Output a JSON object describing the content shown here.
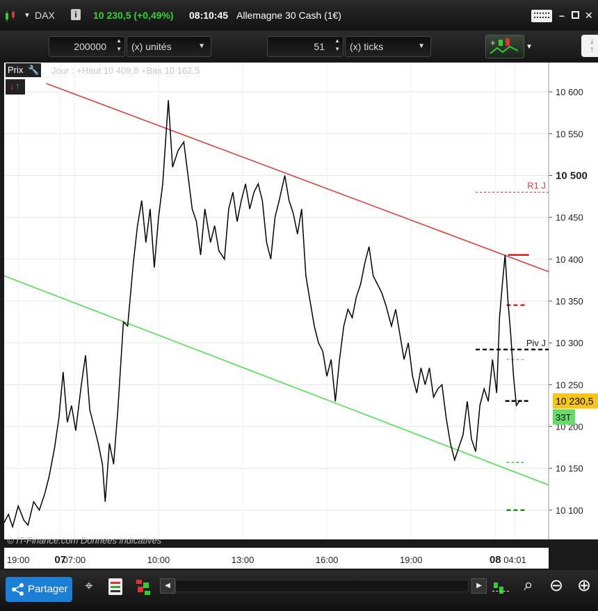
{
  "title_bar": {
    "instrument": "DAX",
    "price_change": "10 230,5 (+0,49%)",
    "time": "08:10:45",
    "market_name": "Allemagne 30 Cash (1€)"
  },
  "toolbar": {
    "quantity_value": "200000",
    "quantity_unit": "(x) unités",
    "ticks_value": "51",
    "ticks_unit": "(x) ticks"
  },
  "chart_header": {
    "price_label": "Prix",
    "info_text": "Jour : +Haut 10 409,8 +Bas 10 162,5",
    "watermark": "© IT-Finance.com  Données indicatives"
  },
  "bottom_bar": {
    "share_label": "Partager"
  },
  "colors": {
    "background": "#ffffff",
    "price_line": "#000000",
    "upper_trendline": "#e04040",
    "lower_trendline": "#50e050",
    "current_price_tag": "#f5c518",
    "tick_count_tag": "#66dd66",
    "share_button": "#1c7fd6"
  },
  "chart_data": {
    "type": "line",
    "instrument": "DAX",
    "yticks": [
      "10 600",
      "10 550",
      "10 500",
      "10 450",
      "10 400",
      "10 350",
      "10 300",
      "10 250",
      "10 200",
      "10 150",
      "10 100"
    ],
    "ylim": [
      10065,
      10635
    ],
    "bold_ytick": "10 500",
    "xticks": [
      "19:00",
      "07",
      "07:00",
      "10:00",
      "13:00",
      "16:00",
      "19:00",
      "08",
      "04:01"
    ],
    "bold_xticks": [
      "07",
      "08"
    ],
    "xtick_positions": [
      0.5,
      2,
      2.5,
      5.5,
      8.5,
      11.5,
      14.5,
      17.5,
      18.2
    ],
    "x_domain": [
      0,
      19.4
    ],
    "grid": true,
    "current_price": "10 230,5",
    "current_price_value": 10230.5,
    "tick_count": "33T",
    "series": [
      {
        "values": [
          [
            0,
            10085
          ],
          [
            0.15,
            10095
          ],
          [
            0.3,
            10080
          ],
          [
            0.5,
            10105
          ],
          [
            0.7,
            10088
          ],
          [
            0.85,
            10082
          ],
          [
            1.05,
            10110
          ],
          [
            1.25,
            10100
          ],
          [
            1.45,
            10120
          ],
          [
            1.6,
            10140
          ],
          [
            1.8,
            10175
          ],
          [
            1.95,
            10210
          ],
          [
            2.1,
            10265
          ],
          [
            2.25,
            10205
          ],
          [
            2.4,
            10225
          ],
          [
            2.55,
            10195
          ],
          [
            2.75,
            10250
          ],
          [
            2.9,
            10285
          ],
          [
            3.05,
            10220
          ],
          [
            3.2,
            10200
          ],
          [
            3.35,
            10180
          ],
          [
            3.5,
            10155
          ],
          [
            3.6,
            10110
          ],
          [
            3.75,
            10180
          ],
          [
            3.9,
            10155
          ],
          [
            4.05,
            10220
          ],
          [
            4.25,
            10325
          ],
          [
            4.4,
            10320
          ],
          [
            4.6,
            10395
          ],
          [
            4.75,
            10440
          ],
          [
            4.9,
            10470
          ],
          [
            5.05,
            10420
          ],
          [
            5.2,
            10460
          ],
          [
            5.35,
            10390
          ],
          [
            5.5,
            10450
          ],
          [
            5.65,
            10490
          ],
          [
            5.85,
            10590
          ],
          [
            6.0,
            10510
          ],
          [
            6.2,
            10530
          ],
          [
            6.4,
            10540
          ],
          [
            6.55,
            10500
          ],
          [
            6.7,
            10460
          ],
          [
            6.85,
            10445
          ],
          [
            7.0,
            10405
          ],
          [
            7.15,
            10460
          ],
          [
            7.35,
            10420
          ],
          [
            7.5,
            10440
          ],
          [
            7.65,
            10410
          ],
          [
            7.85,
            10400
          ],
          [
            8.0,
            10460
          ],
          [
            8.15,
            10480
          ],
          [
            8.3,
            10445
          ],
          [
            8.45,
            10470
          ],
          [
            8.6,
            10490
          ],
          [
            8.75,
            10460
          ],
          [
            8.9,
            10480
          ],
          [
            9.05,
            10490
          ],
          [
            9.2,
            10470
          ],
          [
            9.35,
            10420
          ],
          [
            9.5,
            10400
          ],
          [
            9.65,
            10450
          ],
          [
            9.8,
            10470
          ],
          [
            10.0,
            10500
          ],
          [
            10.15,
            10470
          ],
          [
            10.3,
            10455
          ],
          [
            10.45,
            10430
          ],
          [
            10.6,
            10460
          ],
          [
            10.75,
            10380
          ],
          [
            10.9,
            10350
          ],
          [
            11.05,
            10320
          ],
          [
            11.2,
            10300
          ],
          [
            11.35,
            10290
          ],
          [
            11.5,
            10260
          ],
          [
            11.65,
            10280
          ],
          [
            11.8,
            10230
          ],
          [
            11.95,
            10280
          ],
          [
            12.1,
            10320
          ],
          [
            12.25,
            10340
          ],
          [
            12.4,
            10330
          ],
          [
            12.55,
            10355
          ],
          [
            12.7,
            10370
          ],
          [
            12.85,
            10395
          ],
          [
            13.0,
            10415
          ],
          [
            13.15,
            10380
          ],
          [
            13.3,
            10370
          ],
          [
            13.45,
            10360
          ],
          [
            13.6,
            10345
          ],
          [
            13.8,
            10320
          ],
          [
            13.95,
            10340
          ],
          [
            14.1,
            10310
          ],
          [
            14.25,
            10280
          ],
          [
            14.4,
            10300
          ],
          [
            14.55,
            10260
          ],
          [
            14.7,
            10240
          ],
          [
            14.85,
            10270
          ],
          [
            15.0,
            10250
          ],
          [
            15.15,
            10270
          ],
          [
            15.3,
            10235
          ],
          [
            15.45,
            10245
          ],
          [
            15.6,
            10250
          ],
          [
            15.75,
            10210
          ],
          [
            15.9,
            10180
          ],
          [
            16.05,
            10160
          ],
          [
            16.2,
            10175
          ],
          [
            16.35,
            10190
          ],
          [
            16.5,
            10230
          ],
          [
            16.65,
            10185
          ],
          [
            16.8,
            10170
          ],
          [
            16.95,
            10225
          ],
          [
            17.1,
            10245
          ],
          [
            17.25,
            10230
          ],
          [
            17.4,
            10280
          ],
          [
            17.55,
            10240
          ],
          [
            17.65,
            10330
          ],
          [
            17.75,
            10370
          ],
          [
            17.85,
            10405
          ],
          [
            17.95,
            10350
          ],
          [
            18.05,
            10310
          ],
          [
            18.15,
            10260
          ],
          [
            18.25,
            10225
          ],
          [
            18.35,
            10230
          ]
        ]
      }
    ],
    "trendlines": [
      {
        "points": [
          [
            1.5,
            10610
          ],
          [
            19.4,
            10385
          ]
        ]
      },
      {
        "points": [
          [
            0,
            10380
          ],
          [
            19.4,
            10130
          ]
        ]
      }
    ],
    "markers": [
      {
        "label": "R1 J",
        "value": 10480
      },
      {
        "label": "Piv J",
        "value": 10292
      },
      {
        "label": "",
        "value": 10405
      },
      {
        "label": "",
        "value": 10345
      },
      {
        "label": "",
        "value": 10280
      },
      {
        "label": "",
        "value": 10157
      },
      {
        "label": "",
        "value": 10100
      }
    ]
  }
}
